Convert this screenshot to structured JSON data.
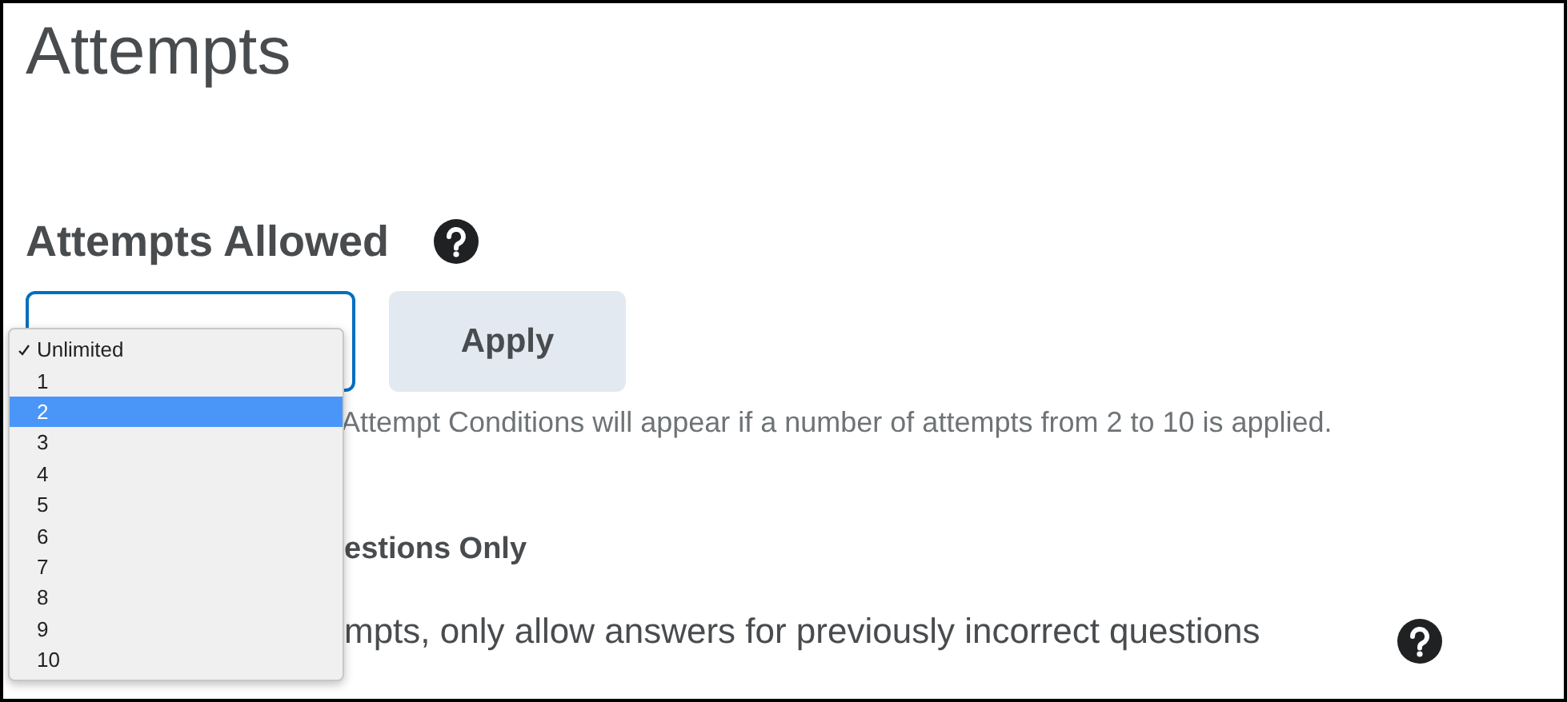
{
  "page_title": "Attempts",
  "attempts_allowed": {
    "label": "Attempts Allowed",
    "apply_button": "Apply",
    "dropdown": [
      {
        "label": "Unlimited",
        "checked": true,
        "selected": false
      },
      {
        "label": "1",
        "checked": false,
        "selected": false
      },
      {
        "label": "2",
        "checked": false,
        "selected": true
      },
      {
        "label": "3",
        "checked": false,
        "selected": false
      },
      {
        "label": "4",
        "checked": false,
        "selected": false
      },
      {
        "label": "5",
        "checked": false,
        "selected": false
      },
      {
        "label": "6",
        "checked": false,
        "selected": false
      },
      {
        "label": "7",
        "checked": false,
        "selected": false
      },
      {
        "label": "8",
        "checked": false,
        "selected": false
      },
      {
        "label": "9",
        "checked": false,
        "selected": false
      },
      {
        "label": "10",
        "checked": false,
        "selected": false
      }
    ],
    "hint": "Attempt Conditions will appear if a number of attempts from 2 to 10 is applied."
  },
  "section": {
    "heading": "estions Only",
    "option": "mpts, only allow answers for previously incorrect questions"
  }
}
